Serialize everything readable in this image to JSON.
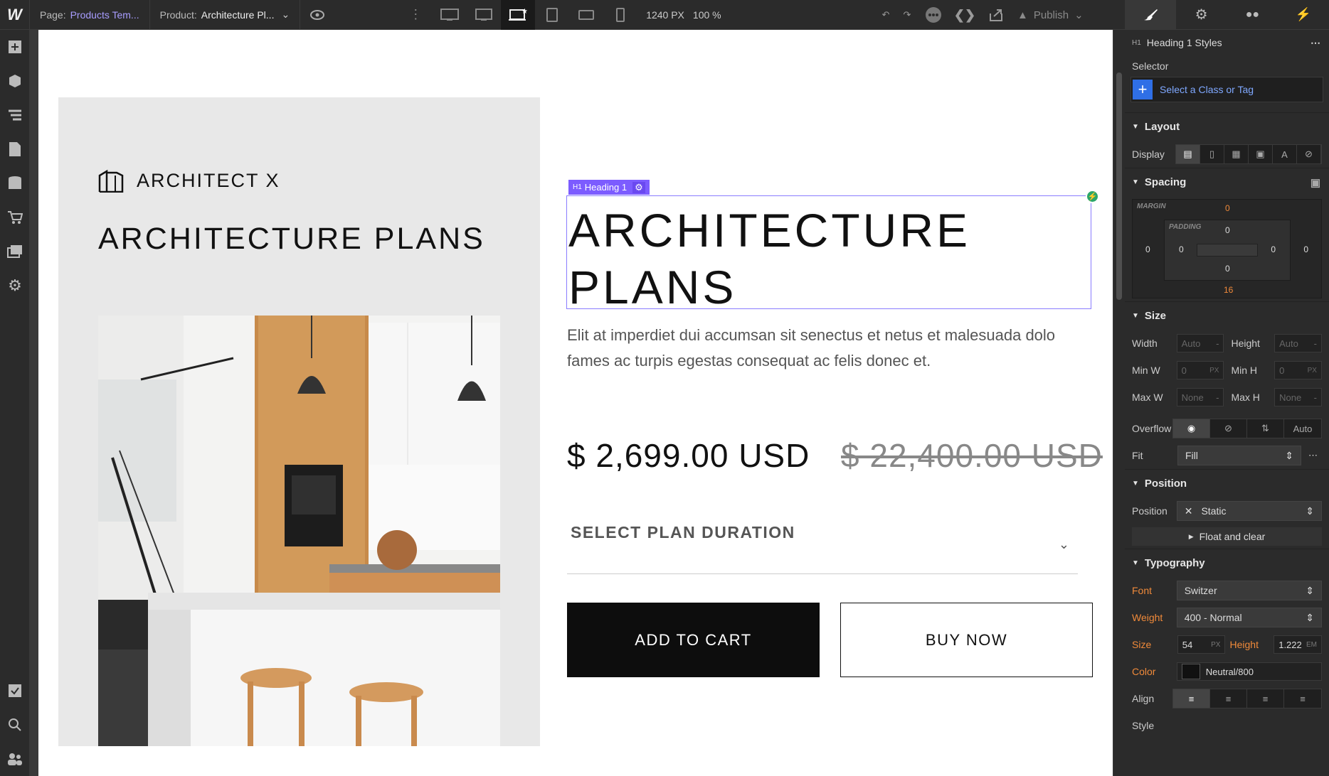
{
  "topbar": {
    "logo": "W",
    "page_label": "Page:",
    "page_value": "Products Tem...",
    "product_label": "Product:",
    "product_value": "Architecture Pl...",
    "width_value": "1240 PX",
    "zoom_value": "100 %",
    "publish_label": "Publish"
  },
  "canvas": {
    "brand_name": "ARCHITECT X",
    "brand_title": "ARCHITECTURE PLANS",
    "selection_tag": "Heading 1",
    "selection_tag_prefix": "H1",
    "heading_line1": "ARCHITECTURE",
    "heading_line2": "PLANS",
    "description": "Elit at imperdiet dui accumsan sit senectus et netus et malesuada dolo fames ac turpis egestas consequat ac felis donec et.",
    "price": "$ 2,699.00 USD",
    "old_price": "$ 22,400.00 USD",
    "select_label": "SELECT PLAN DURATION",
    "add_to_cart": "ADD TO CART",
    "buy_now": "BUY NOW"
  },
  "panel": {
    "header_prefix": "H1",
    "header_title": "Heading 1 Styles",
    "selector_label": "Selector",
    "selector_placeholder": "Select a Class or Tag",
    "layout_title": "Layout",
    "display_label": "Display",
    "spacing_title": "Spacing",
    "margin_label": "MARGIN",
    "padding_label": "PADDING",
    "margin_top": "0",
    "margin_bottom": "16",
    "margin_left": "0",
    "margin_right": "0",
    "padding_top": "0",
    "padding_bottom": "0",
    "padding_left": "0",
    "padding_right": "0",
    "size_title": "Size",
    "width_label": "Width",
    "width_value": "Auto",
    "height_label": "Height",
    "height_value": "Auto",
    "minw_label": "Min W",
    "minw_value": "0",
    "minh_label": "Min H",
    "minh_value": "0",
    "maxw_label": "Max W",
    "maxw_value": "None",
    "maxh_label": "Max H",
    "maxh_value": "None",
    "unit_px": "PX",
    "unit_dash": "-",
    "overflow_label": "Overflow",
    "overflow_auto": "Auto",
    "fit_label": "Fit",
    "fit_value": "Fill",
    "position_title": "Position",
    "position_label": "Position",
    "position_value": "Static",
    "float_clear": "Float and clear",
    "typography_title": "Typography",
    "font_label": "Font",
    "font_value": "Switzer",
    "weight_label": "Weight",
    "weight_value": "400 - Normal",
    "size_label": "Size",
    "size_value": "54",
    "line_height_label": "Height",
    "line_height_value": "1.222",
    "unit_em": "EM",
    "color_label": "Color",
    "color_value": "Neutral/800",
    "align_label": "Align",
    "style_label": "Style"
  },
  "colors": {
    "accent": "#7c5cff",
    "link": "#7fa8ff",
    "override": "#f08a3a",
    "panel_bg": "#2b2b2b"
  }
}
